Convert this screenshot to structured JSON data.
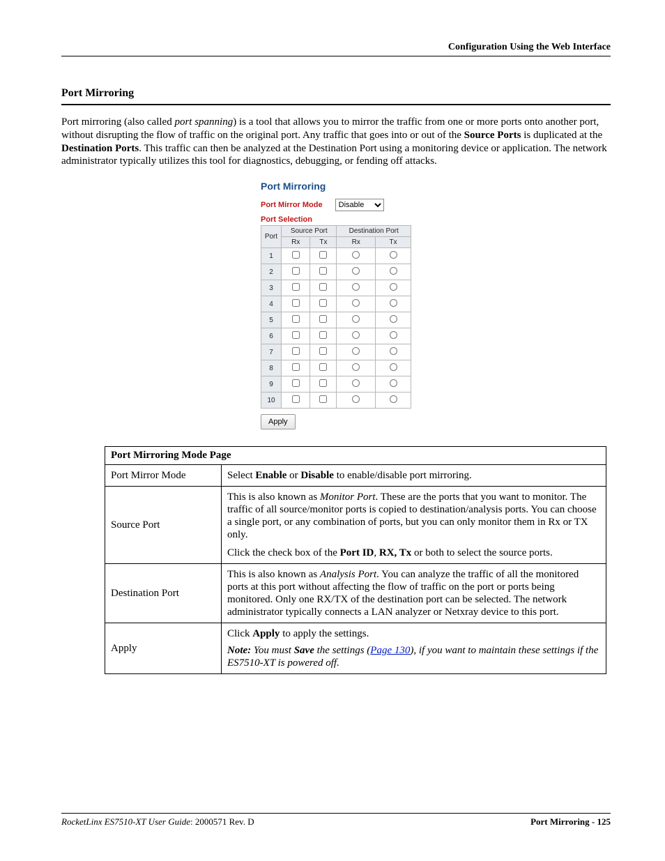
{
  "header": {
    "running_head": "Configuration Using the Web Interface"
  },
  "section": {
    "title": "Port Mirroring",
    "intro_pre": "Port mirroring (also called ",
    "intro_em": "port spanning",
    "intro_mid1": ") is a tool that allows you to mirror the traffic from one or more ports onto another port, without disrupting the flow of traffic on the original port. Any traffic that goes into or out of the ",
    "intro_b1": "Source Ports",
    "intro_mid2": " is duplicated at the ",
    "intro_b2": "Destination Ports",
    "intro_mid3": ". This traffic can then be analyzed at the Destination Port using a monitoring device or application. The network administrator typically utilizes this tool for diagnostics, debugging, or fending off attacks."
  },
  "ui": {
    "title": "Port Mirroring",
    "mode_label": "Port Mirror Mode",
    "mode_value": "Disable",
    "selection_label": "Port Selection",
    "col_port": "Port",
    "col_source": "Source Port",
    "col_dest": "Destination Port",
    "col_rx": "Rx",
    "col_tx": "Tx",
    "ports": [
      "1",
      "2",
      "3",
      "4",
      "5",
      "6",
      "7",
      "8",
      "9",
      "10"
    ],
    "apply": "Apply"
  },
  "desc": {
    "title": "Port Mirroring Mode Page",
    "rows": {
      "mode": {
        "label": "Port Mirror Mode",
        "pre": "Select ",
        "b1": "Enable",
        "or": " or ",
        "b2": "Disable",
        "post": " to enable/disable port mirroring."
      },
      "source": {
        "label": "Source Port",
        "p1_pre": "This is also known as ",
        "p1_em": "Monitor Port",
        "p1_post": ". These are the ports that you want to monitor. The traffic of all source/monitor ports is copied to destination/analysis ports. You can choose a single port, or any combination of ports, but you can only monitor them in Rx or TX only.",
        "p2_pre": "Click the check box of the ",
        "p2_b1": "Port ID",
        "p2_sep1": ", ",
        "p2_b2": "RX, Tx",
        "p2_post": " or both to select the source ports."
      },
      "dest": {
        "label": "Destination Port",
        "p_pre": "This is also known as ",
        "p_em": "Analysis Port",
        "p_post": ". You can analyze the traffic of all the monitored ports at this port without affecting the flow of traffic on the port or ports being monitored. Only one RX/TX of the destination port can be selected. The network administrator typically connects a LAN analyzer or Netxray device to this port."
      },
      "apply": {
        "label": "Apply",
        "p1_pre": "Click ",
        "p1_b": "Apply",
        "p1_post": " to apply the settings.",
        "note_lead": "Note:",
        "note_spacer": "  ",
        "note_pre": "You must ",
        "note_b": "Save",
        "note_mid": " the settings (",
        "note_link": "Page 130",
        "note_post": "), if you want to maintain these settings if the ES7510-XT is powered off."
      }
    }
  },
  "footer": {
    "left_italic": "RocketLinx ES7510-XT  User Guide",
    "left_rest": ": 2000571 Rev. D",
    "right": "Port Mirroring - 125"
  }
}
